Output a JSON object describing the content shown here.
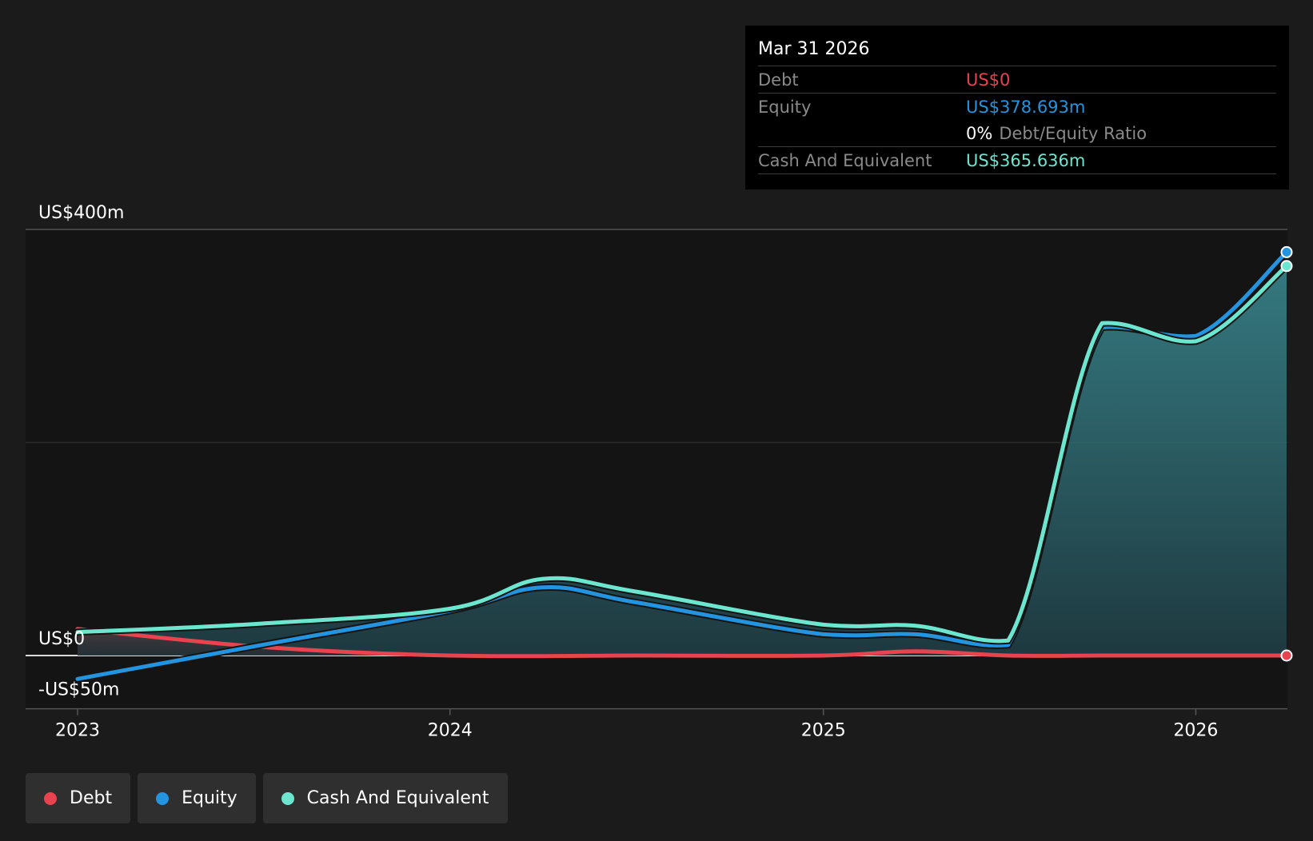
{
  "tooltip": {
    "date": "Mar 31 2026",
    "rows": {
      "debt": {
        "label": "Debt",
        "value": "US$0"
      },
      "equity": {
        "label": "Equity",
        "value": "US$378.693m"
      },
      "ratio": {
        "value": "0%",
        "label": "Debt/Equity Ratio"
      },
      "cash": {
        "label": "Cash And Equivalent",
        "value": "US$365.636m"
      }
    }
  },
  "legend": {
    "items": [
      {
        "label": "Debt",
        "color": "#e8434f"
      },
      {
        "label": "Equity",
        "color": "#2394df"
      },
      {
        "label": "Cash And Equivalent",
        "color": "#6ce6cf"
      }
    ]
  },
  "chart_data": {
    "type": "line",
    "title": "",
    "xlabel": "",
    "ylabel": "",
    "y_unit": "US$ millions",
    "ylim": [
      -50,
      400
    ],
    "xlim": [
      "2023-01-01",
      "2026-03-31"
    ],
    "y_tick_labels": [
      {
        "value": 400,
        "label": "US$400m"
      },
      {
        "value": 0,
        "label": "US$0"
      },
      {
        "value": -50,
        "label": "-US$50m"
      }
    ],
    "gridlines": [
      400,
      200,
      0,
      -50
    ],
    "x_tick_labels": [
      {
        "value": "2023-01-01",
        "label": "2023"
      },
      {
        "value": "2024-01-01",
        "label": "2024"
      },
      {
        "value": "2025-01-01",
        "label": "2025"
      },
      {
        "value": "2026-01-01",
        "label": "2026"
      }
    ],
    "series": [
      {
        "name": "Debt",
        "color": "#e8434f",
        "points": [
          [
            "2023-01-01",
            25
          ],
          [
            "2023-07-01",
            8
          ],
          [
            "2024-01-01",
            0
          ],
          [
            "2024-07-01",
            0
          ],
          [
            "2025-01-01",
            0
          ],
          [
            "2025-04-01",
            4
          ],
          [
            "2025-07-01",
            0
          ],
          [
            "2025-10-01",
            0
          ],
          [
            "2026-01-01",
            0
          ],
          [
            "2026-03-31",
            0
          ]
        ]
      },
      {
        "name": "Equity",
        "color": "#2394df",
        "points": [
          [
            "2023-01-01",
            -22
          ],
          [
            "2023-07-01",
            10
          ],
          [
            "2024-01-01",
            42
          ],
          [
            "2024-04-01",
            64
          ],
          [
            "2024-07-01",
            50
          ],
          [
            "2025-01-01",
            20
          ],
          [
            "2025-04-01",
            20
          ],
          [
            "2025-07-01",
            10
          ],
          [
            "2025-10-01",
            308
          ],
          [
            "2026-01-01",
            300
          ],
          [
            "2026-03-31",
            378.693
          ]
        ]
      },
      {
        "name": "Cash And Equivalent",
        "color": "#6ce6cf",
        "points": [
          [
            "2023-01-01",
            22
          ],
          [
            "2023-07-01",
            30
          ],
          [
            "2024-01-01",
            44
          ],
          [
            "2024-04-01",
            72
          ],
          [
            "2024-07-01",
            60
          ],
          [
            "2025-01-01",
            29
          ],
          [
            "2025-04-01",
            28
          ],
          [
            "2025-07-01",
            14
          ],
          [
            "2025-10-01",
            312
          ],
          [
            "2026-01-01",
            295
          ],
          [
            "2026-03-31",
            365.636
          ]
        ]
      }
    ],
    "legend_position": "bottom-left"
  }
}
